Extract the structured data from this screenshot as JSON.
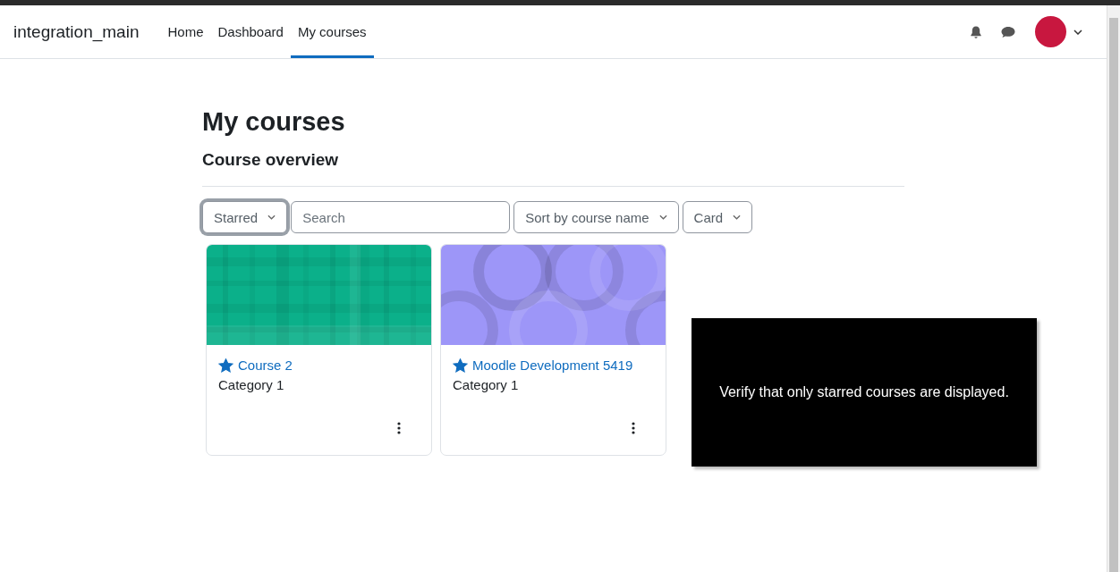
{
  "site_name": "integration_main",
  "nav": [
    {
      "label": "Home",
      "selected": false
    },
    {
      "label": "Dashboard",
      "selected": false
    },
    {
      "label": "My courses",
      "selected": true
    }
  ],
  "page_title": "My courses",
  "section_title": "Course overview",
  "filters": {
    "grouping": "Starred",
    "search": {
      "placeholder": "Search"
    },
    "sort": "Sort by course name",
    "view": "Card"
  },
  "courses": [
    {
      "name": "Course 2",
      "category": "Category 1",
      "starred": true,
      "kind": "plaid",
      "color": "#0bb08a"
    },
    {
      "name": "Moodle Development 5419",
      "category": "Category 1",
      "starred": true,
      "kind": "circles",
      "color": "#9d96f8"
    }
  ],
  "overlay_message": "Verify that only starred courses are displayed."
}
